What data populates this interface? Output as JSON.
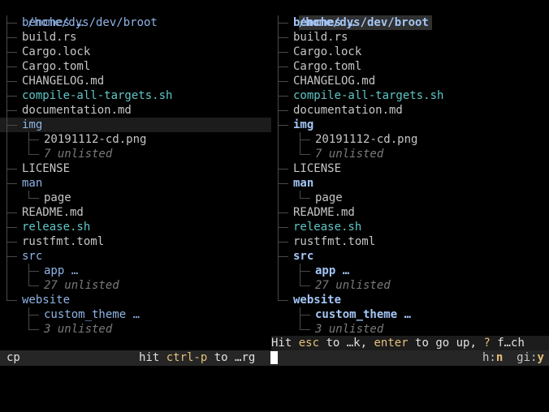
{
  "left_panel": {
    "root": "/home/dys/dev/broot",
    "rows": [
      {
        "name": "benches …",
        "kind": "dir",
        "depth": 1,
        "last": false
      },
      {
        "name": "build.rs",
        "kind": "file",
        "depth": 1,
        "last": false
      },
      {
        "name": "Cargo.lock",
        "kind": "file",
        "depth": 1,
        "last": false
      },
      {
        "name": "Cargo.toml",
        "kind": "file",
        "depth": 1,
        "last": false
      },
      {
        "name": "CHANGELOG.md",
        "kind": "file",
        "depth": 1,
        "last": false
      },
      {
        "name": "compile-all-targets.sh",
        "kind": "exe",
        "depth": 1,
        "last": false
      },
      {
        "name": "documentation.md",
        "kind": "file",
        "depth": 1,
        "last": false
      },
      {
        "name": "img",
        "kind": "dir",
        "depth": 1,
        "last": false,
        "selected": true
      },
      {
        "name": "20191112-cd.png",
        "kind": "file",
        "depth": 2,
        "last": false
      },
      {
        "name": "7 unlisted",
        "kind": "unlisted",
        "depth": 2,
        "last": true
      },
      {
        "name": "LICENSE",
        "kind": "file",
        "depth": 1,
        "last": false
      },
      {
        "name": "man",
        "kind": "dir",
        "depth": 1,
        "last": false
      },
      {
        "name": "page",
        "kind": "file",
        "depth": 2,
        "last": true
      },
      {
        "name": "README.md",
        "kind": "file",
        "depth": 1,
        "last": false
      },
      {
        "name": "release.sh",
        "kind": "exe",
        "depth": 1,
        "last": false
      },
      {
        "name": "rustfmt.toml",
        "kind": "file",
        "depth": 1,
        "last": false
      },
      {
        "name": "src",
        "kind": "dir",
        "depth": 1,
        "last": false
      },
      {
        "name": "app …",
        "kind": "dir",
        "depth": 2,
        "last": false
      },
      {
        "name": "27 unlisted",
        "kind": "unlisted",
        "depth": 2,
        "last": true
      },
      {
        "name": "website",
        "kind": "dir",
        "depth": 1,
        "last": true
      },
      {
        "name": "custom_theme …",
        "kind": "dir",
        "depth": 2,
        "last": false
      },
      {
        "name": "3 unlisted",
        "kind": "unlisted",
        "depth": 2,
        "last": true
      }
    ]
  },
  "right_panel": {
    "root": "/home/dys/dev/broot",
    "rows": [
      {
        "name": "benches …",
        "kind": "dir",
        "depth": 1,
        "last": false
      },
      {
        "name": "build.rs",
        "kind": "file",
        "depth": 1,
        "last": false
      },
      {
        "name": "Cargo.lock",
        "kind": "file",
        "depth": 1,
        "last": false
      },
      {
        "name": "Cargo.toml",
        "kind": "file",
        "depth": 1,
        "last": false
      },
      {
        "name": "CHANGELOG.md",
        "kind": "file",
        "depth": 1,
        "last": false
      },
      {
        "name": "compile-all-targets.sh",
        "kind": "exe",
        "depth": 1,
        "last": false
      },
      {
        "name": "documentation.md",
        "kind": "file",
        "depth": 1,
        "last": false
      },
      {
        "name": "img",
        "kind": "dir",
        "depth": 1,
        "last": false
      },
      {
        "name": "20191112-cd.png",
        "kind": "file",
        "depth": 2,
        "last": false
      },
      {
        "name": "7 unlisted",
        "kind": "unlisted",
        "depth": 2,
        "last": true
      },
      {
        "name": "LICENSE",
        "kind": "file",
        "depth": 1,
        "last": false
      },
      {
        "name": "man",
        "kind": "dir",
        "depth": 1,
        "last": false
      },
      {
        "name": "page",
        "kind": "file",
        "depth": 2,
        "last": true
      },
      {
        "name": "README.md",
        "kind": "file",
        "depth": 1,
        "last": false
      },
      {
        "name": "release.sh",
        "kind": "exe",
        "depth": 1,
        "last": false
      },
      {
        "name": "rustfmt.toml",
        "kind": "file",
        "depth": 1,
        "last": false
      },
      {
        "name": "src",
        "kind": "dir",
        "depth": 1,
        "last": false
      },
      {
        "name": "app …",
        "kind": "dir",
        "depth": 2,
        "last": false
      },
      {
        "name": "27 unlisted",
        "kind": "unlisted",
        "depth": 2,
        "last": true
      },
      {
        "name": "website",
        "kind": "dir",
        "depth": 1,
        "last": true
      },
      {
        "name": "custom_theme …",
        "kind": "dir",
        "depth": 2,
        "last": false
      },
      {
        "name": "3 unlisted",
        "kind": "unlisted",
        "depth": 2,
        "last": true
      }
    ]
  },
  "status": {
    "hit1": "Hit ",
    "key_esc": "esc",
    "t1": " to ",
    "t2": "…k, ",
    "key_enter": "enter",
    "t3": " to go up, ",
    "key_q": "?",
    "t4": " f…ch"
  },
  "input": {
    "verb": "cp",
    "hint_hit": "hit ",
    "hint_key": "ctrl-p",
    "hint_rest": " to …rg",
    "flag_h_label": "h:",
    "flag_h_value": "n",
    "flag_gi_label": "gi:",
    "flag_gi_value": "y"
  },
  "colors": {
    "dir": "#8fb3e6",
    "exe": "#5fc6c6",
    "file": "#c6c6c6",
    "key": "#e5c07b",
    "unlisted": "#7a7a7a"
  }
}
